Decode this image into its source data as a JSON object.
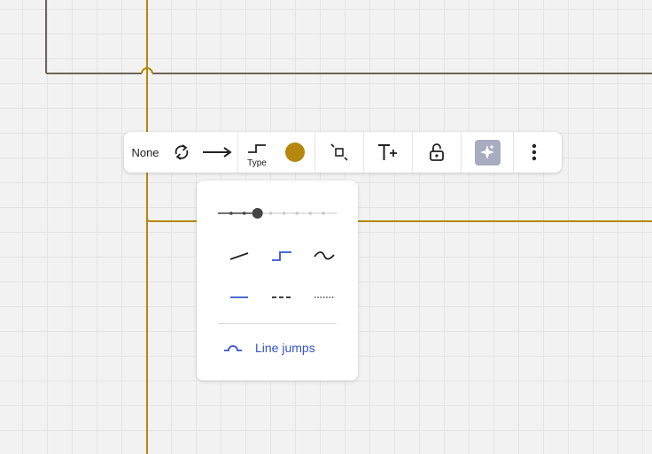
{
  "colors": {
    "canvas_bg": "#f2f2f2",
    "connector_gold": "#b5870d",
    "connector_gray": "#6f6458",
    "accent_blue": "#3355cc",
    "icon_dark": "#222222",
    "slider_track": "#c8c8c8",
    "ai_bg": "#a8acc0"
  },
  "toolbar": {
    "arrow_start_label": "None",
    "line_type_label": "Type",
    "line_color": "#b5870d",
    "icons": [
      "swap-icon",
      "arrow-end-icon",
      "line-type-icon",
      "color-swatch",
      "fit-shape-icon",
      "add-text-icon",
      "unlock-icon",
      "ai-sparkle-icon",
      "more-options-icon"
    ]
  },
  "line_panel": {
    "thickness_steps": 8,
    "thickness_selected": 3,
    "shapes": [
      "straight",
      "elbow",
      "curved"
    ],
    "shape_selected": "elbow",
    "styles": [
      "solid",
      "dashed",
      "dotted"
    ],
    "style_selected": "solid",
    "line_jumps_label": "Line jumps"
  }
}
